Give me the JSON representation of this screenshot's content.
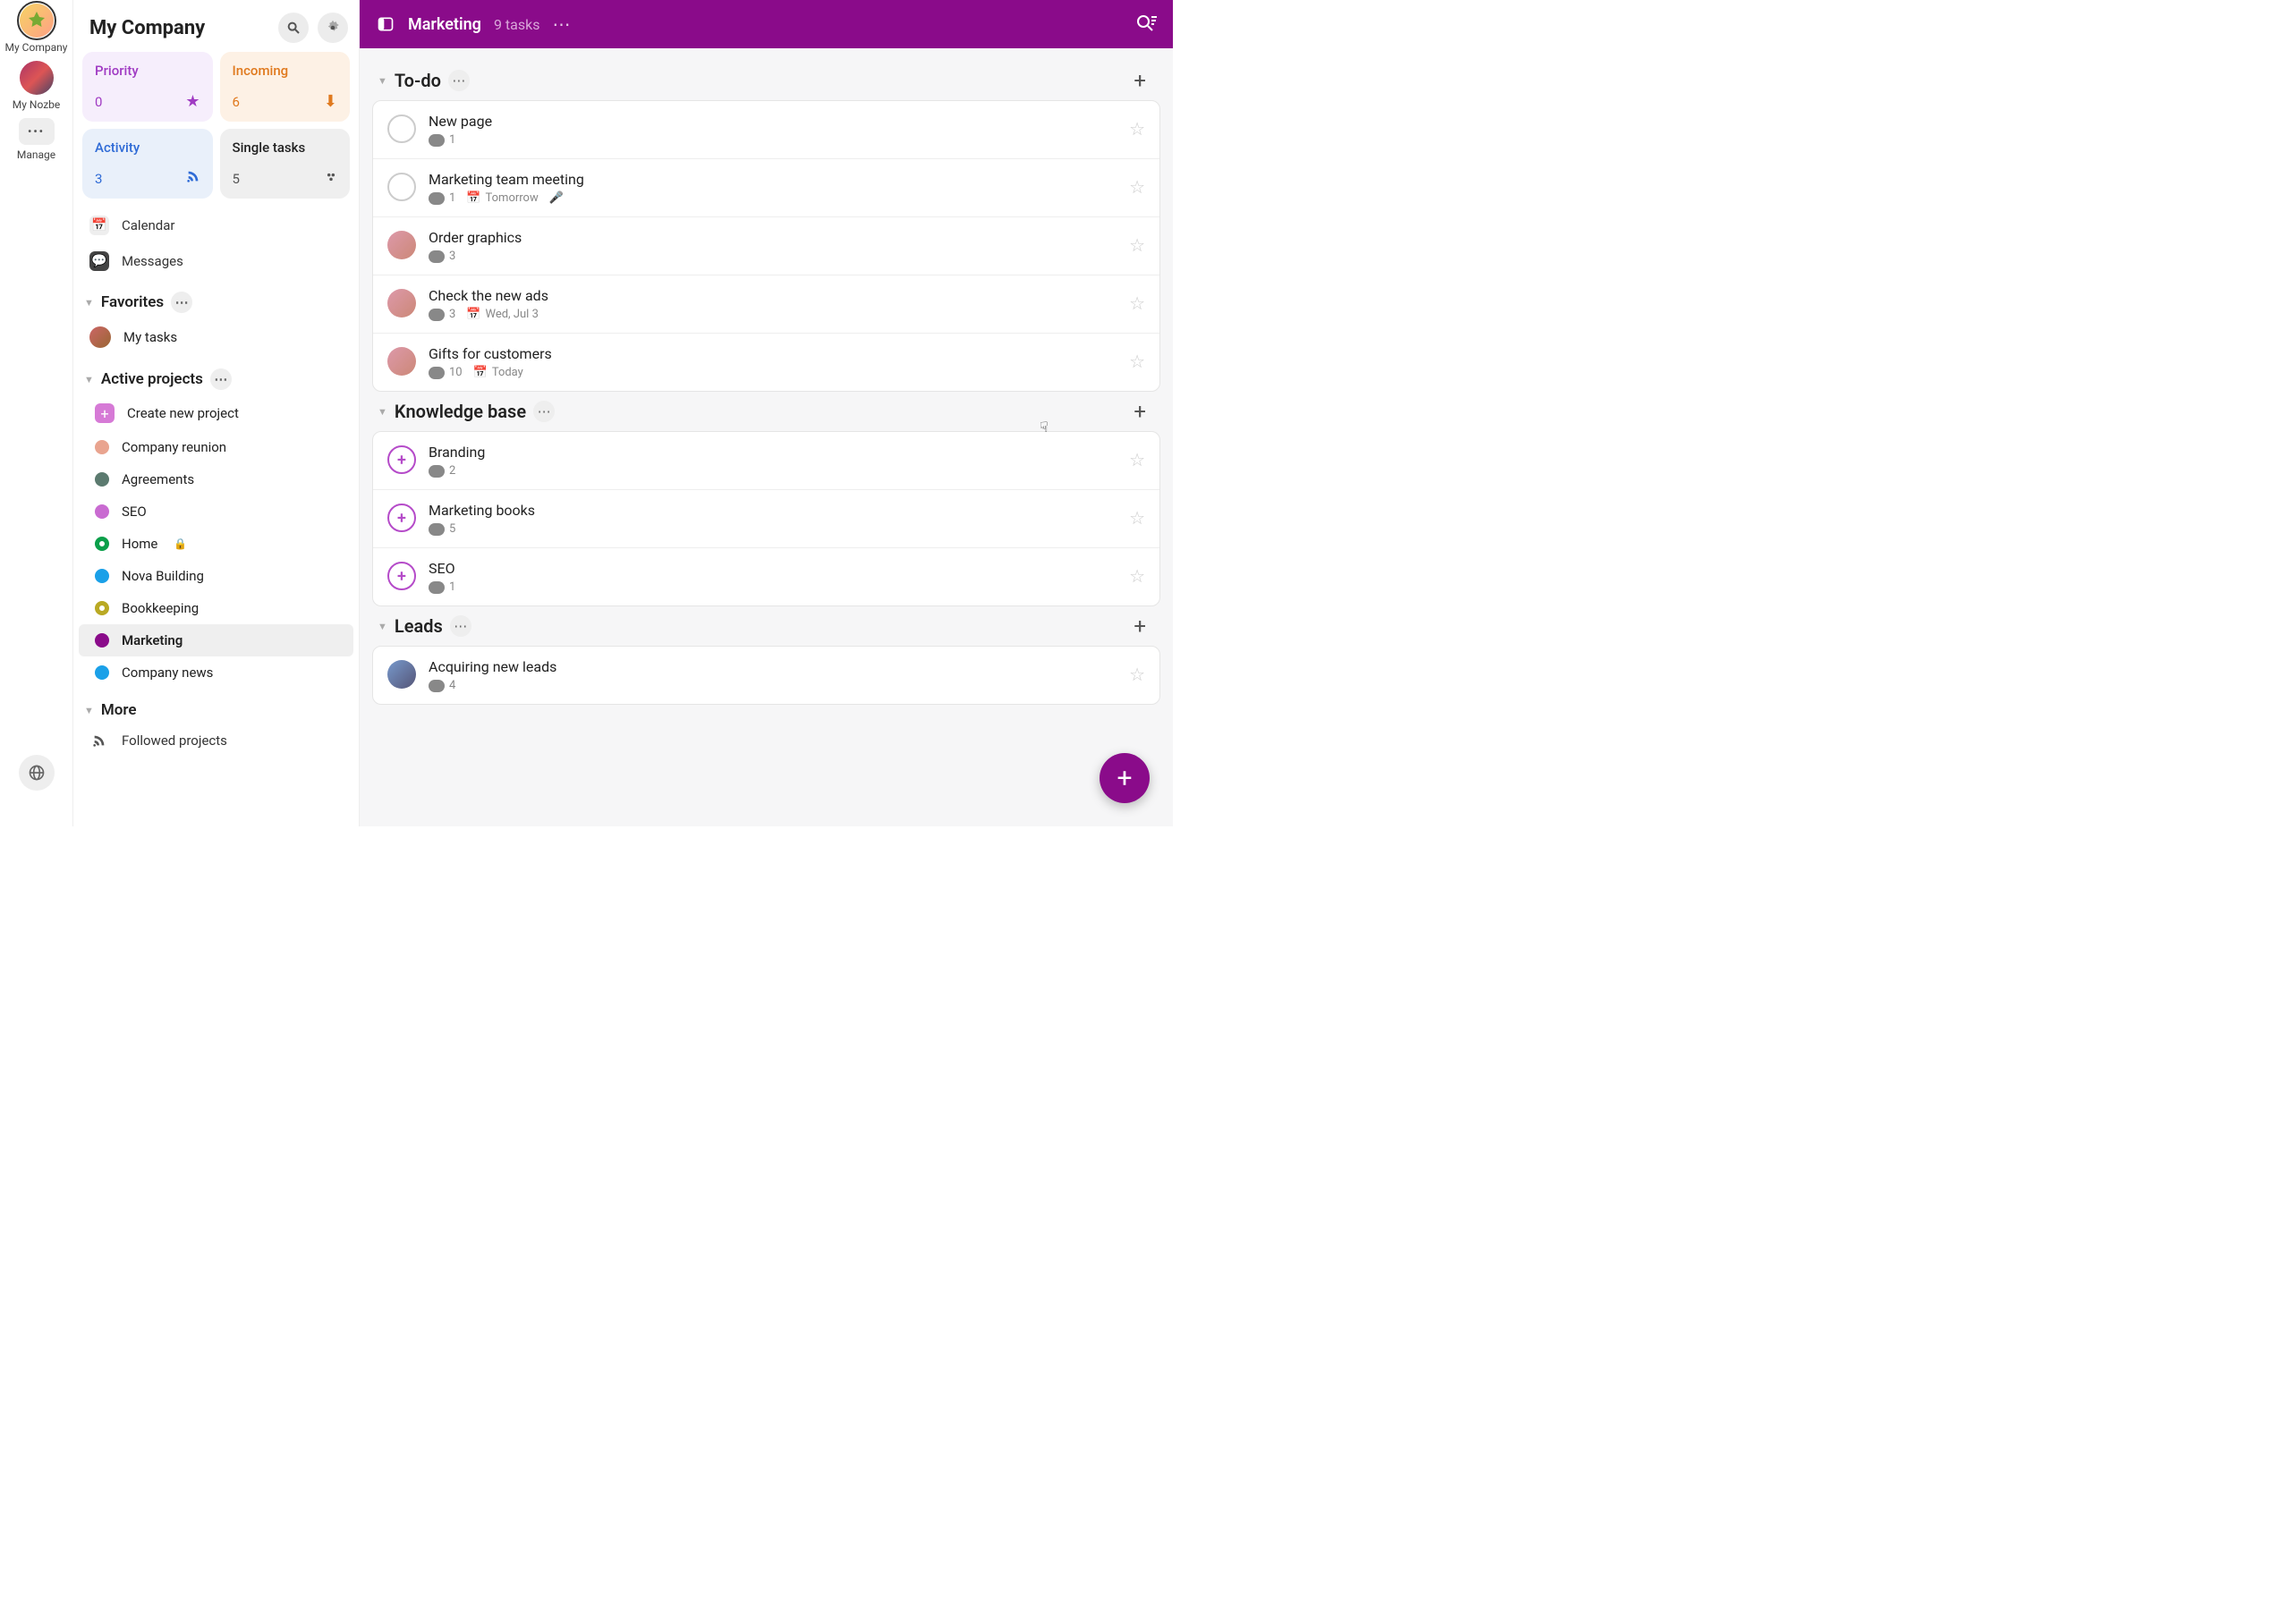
{
  "rail": {
    "items": [
      {
        "label": "My Company",
        "active": true
      },
      {
        "label": "My Nozbe"
      },
      {
        "label": "Manage",
        "type": "box"
      }
    ]
  },
  "sidebar": {
    "title": "My Company",
    "tiles": {
      "priority": {
        "name": "Priority",
        "count": "0"
      },
      "incoming": {
        "name": "Incoming",
        "count": "6"
      },
      "activity": {
        "name": "Activity",
        "count": "3"
      },
      "single": {
        "name": "Single tasks",
        "count": "5"
      }
    },
    "nav": {
      "calendar": "Calendar",
      "messages": "Messages"
    },
    "favorites": {
      "heading": "Favorites",
      "items": [
        {
          "label": "My tasks"
        }
      ]
    },
    "projects": {
      "heading": "Active projects",
      "create": "Create new project",
      "items": [
        {
          "label": "Company reunion",
          "color": "#e9a48f"
        },
        {
          "label": "Agreements",
          "color": "#5b7a6f"
        },
        {
          "label": "SEO",
          "color": "#c96bd1"
        },
        {
          "label": "Home",
          "color": "#0a9f4a",
          "locked": true,
          "ring": true
        },
        {
          "label": "Nova Building",
          "color": "#1aa0e8"
        },
        {
          "label": "Bookkeeping",
          "color": "#b9a923",
          "ring": true
        },
        {
          "label": "Marketing",
          "color": "#8a0b8a",
          "active": true
        },
        {
          "label": "Company news",
          "color": "#1aa0e8"
        }
      ]
    },
    "more": {
      "heading": "More",
      "followed": "Followed projects"
    }
  },
  "topbar": {
    "title": "Marketing",
    "subtitle": "9 tasks"
  },
  "sections": [
    {
      "title": "To-do",
      "tasks": [
        {
          "name": "New page",
          "comments": "1",
          "avatar": "empty"
        },
        {
          "name": "Marketing team meeting",
          "comments": "1",
          "date": "Tomorrow",
          "mic": true,
          "avatar": "empty"
        },
        {
          "name": "Order graphics",
          "comments": "3",
          "avatar": "person"
        },
        {
          "name": "Check the new ads",
          "comments": "3",
          "date": "Wed, Jul 3",
          "avatar": "person"
        },
        {
          "name": "Gifts for customers",
          "comments": "10",
          "date": "Today",
          "avatar": "person"
        }
      ]
    },
    {
      "title": "Knowledge base",
      "tasks": [
        {
          "name": "Branding",
          "comments": "2",
          "avatar": "plus"
        },
        {
          "name": "Marketing books",
          "comments": "5",
          "avatar": "plus"
        },
        {
          "name": "SEO",
          "comments": "1",
          "avatar": "plus"
        }
      ]
    },
    {
      "title": "Leads",
      "tasks": [
        {
          "name": "Acquiring new leads",
          "comments": "4",
          "avatar": "person2"
        }
      ]
    }
  ]
}
